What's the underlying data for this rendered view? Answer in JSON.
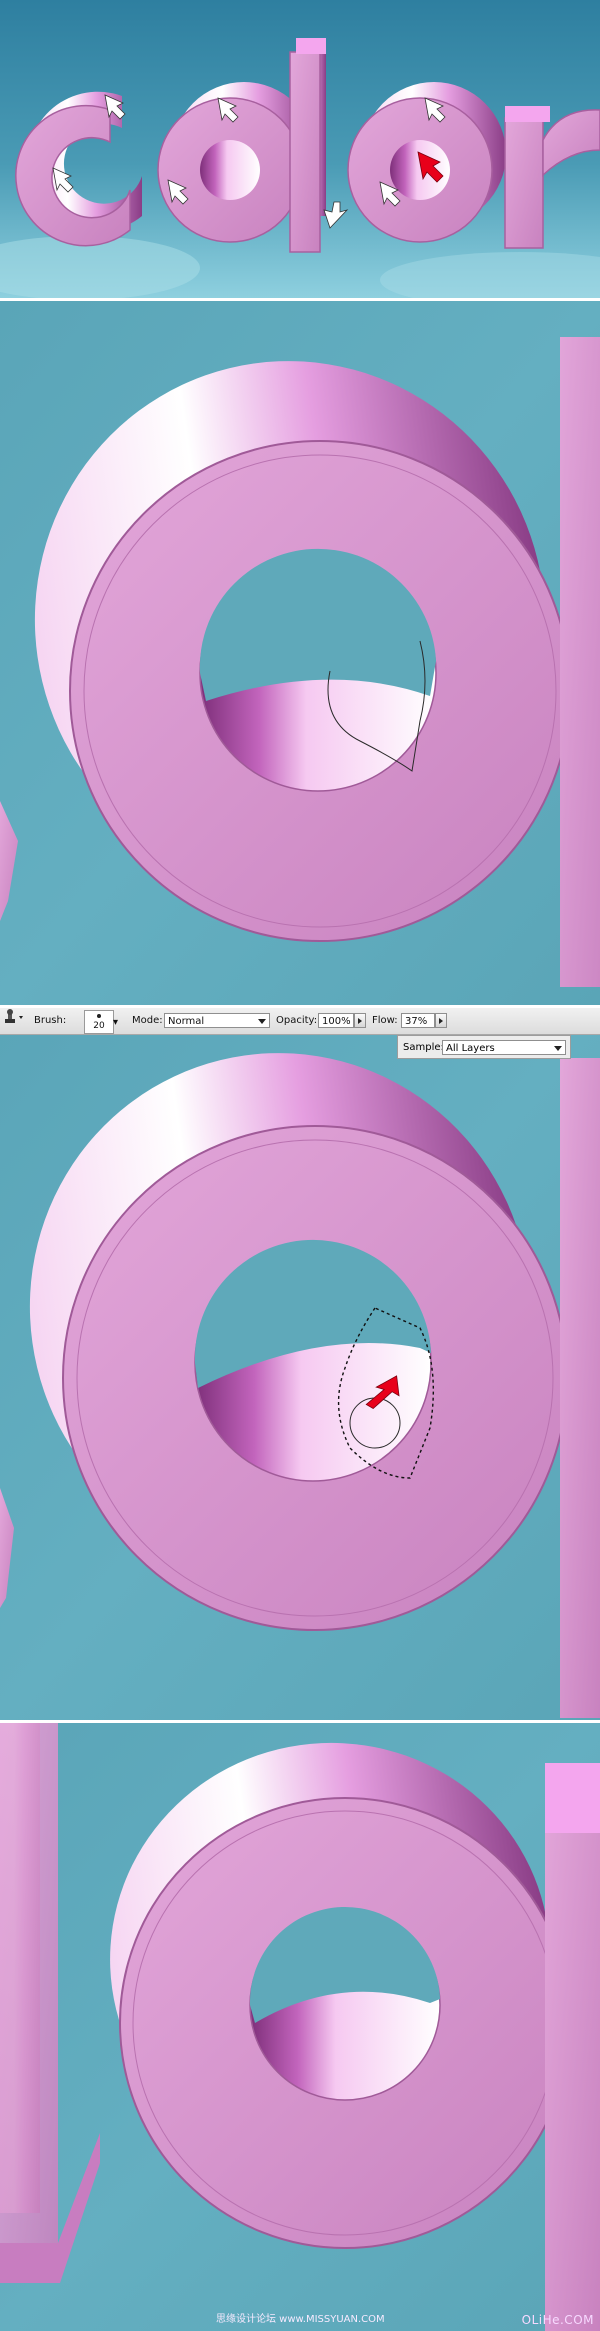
{
  "title_art": {
    "word": "color"
  },
  "toolbar": {
    "brush_label": "Brush:",
    "brush_size": "20",
    "mode_label": "Mode:",
    "mode_value": "Normal",
    "opacity_label": "Opacity:",
    "opacity_value": "100%",
    "flow_label": "Flow:",
    "flow_value": "37%",
    "sample_label": "Sample:",
    "sample_value": "All Layers"
  },
  "watermark": {
    "site": "OLiHe.COM",
    "cn": "思缘设计论坛 www.MISSYUAN.COM"
  },
  "colors": {
    "background": "#5ea9bb",
    "letter_pink": "#d891cf",
    "arrow_white": "#ffffff",
    "arrow_red": "#e8001a",
    "options_bar": "#e2e2e2"
  },
  "icons": [
    "clone-stamp-icon",
    "arrow-white-icon",
    "arrow-red-icon",
    "dropdown-arrow-icon",
    "stepper-arrow-icon"
  ]
}
